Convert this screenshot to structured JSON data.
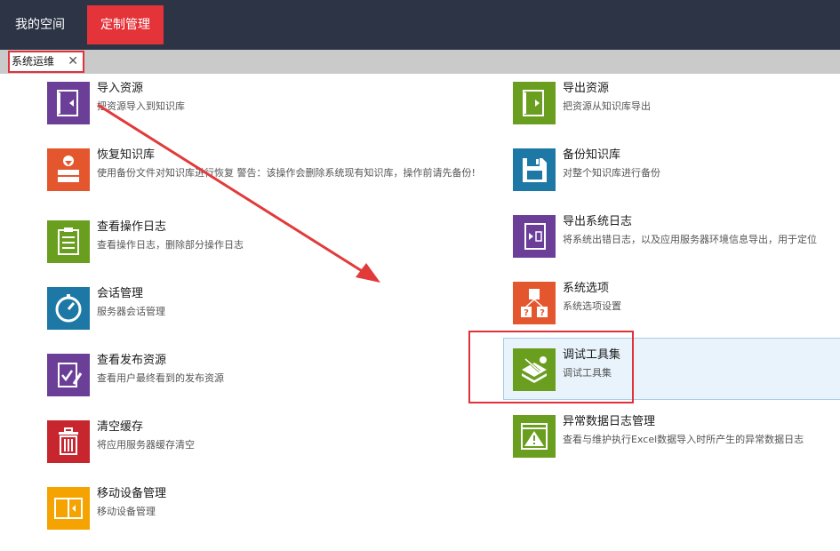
{
  "nav": {
    "my_space": "我的空间",
    "custom_mgmt": "定制管理"
  },
  "subtab": {
    "label": "系统运维",
    "close": "✕"
  },
  "colors": {
    "topbar": "#2c3446",
    "active_tab": "#e5333a",
    "purple": "#6b3f98",
    "orange": "#e4572e",
    "green": "#6a9e1f",
    "teal": "#1e78a6",
    "red": "#c8262e",
    "yellow": "#f4a300",
    "highlight": "#e0323a"
  },
  "left_items": [
    {
      "title": "导入资源",
      "desc": "把资源导入到知识库",
      "icon": "import-book-icon",
      "color": "purple"
    },
    {
      "title": "恢复知识库",
      "desc": "使用备份文件对知识库进行恢复 警告：该操作会删除系统现有知识库，操作前请先备份!",
      "icon": "restore-icon",
      "color": "orange"
    },
    {
      "title": "查看操作日志",
      "desc": "查看操作日志，删除部分操作日志",
      "icon": "log-clipboard-icon",
      "color": "green"
    },
    {
      "title": "会话管理",
      "desc": "服务器会话管理",
      "icon": "session-gauge-icon",
      "color": "teal"
    },
    {
      "title": "查看发布资源",
      "desc": "查看用户最终看到的发布资源",
      "icon": "publish-check-icon",
      "color": "purple"
    },
    {
      "title": "清空缓存",
      "desc": "将应用服务器缓存清空",
      "icon": "trash-icon",
      "color": "red"
    },
    {
      "title": "移动设备管理",
      "desc": "移动设备管理",
      "icon": "mobile-book-icon",
      "color": "yellow"
    }
  ],
  "right_items": [
    {
      "title": "导出资源",
      "desc": "把资源从知识库导出",
      "icon": "export-book-icon",
      "color": "green"
    },
    {
      "title": "备份知识库",
      "desc": "对整个知识库进行备份",
      "icon": "floppy-disk-icon",
      "color": "teal"
    },
    {
      "title": "导出系统日志",
      "desc": "将系统出错日志，以及应用服务器环境信息导出，用于定位",
      "icon": "export-log-icon",
      "color": "purple"
    },
    {
      "title": "系统选项",
      "desc": "系统选项设置",
      "icon": "system-options-icon",
      "color": "orange"
    },
    {
      "title": "调试工具集",
      "desc": "调试工具集",
      "icon": "debug-tools-icon",
      "color": "green"
    },
    {
      "title": "异常数据日志管理",
      "desc": "查看与维护执行Excel数据导入时所产生的异常数据日志",
      "icon": "warning-calendar-icon",
      "color": "green"
    }
  ]
}
